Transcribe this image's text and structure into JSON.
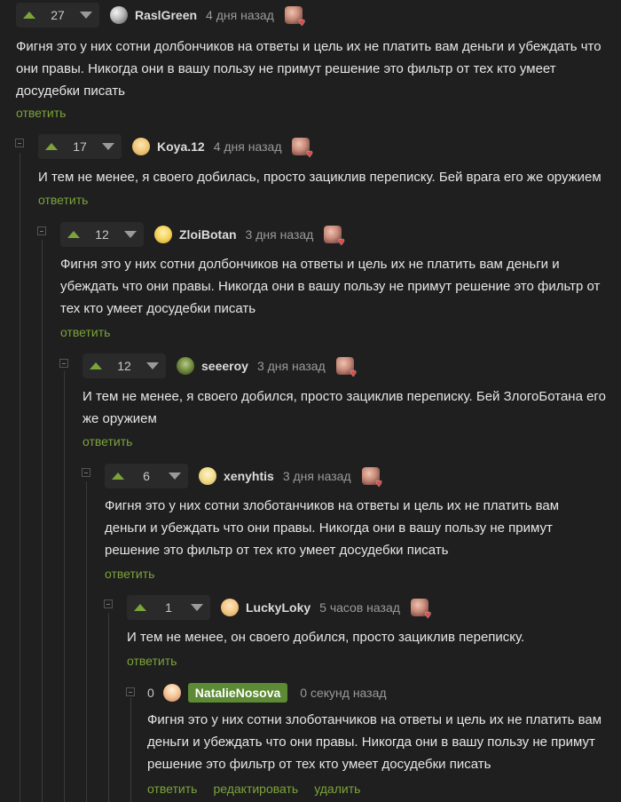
{
  "comments": [
    {
      "score": "27",
      "username": "RaslGreen",
      "time": "4 дня назад",
      "text": "Фигня это у них сотни долбончиков на ответы и цель их не платить вам деньги и убеждать что они правы. Никогда они в вашу пользу не примут решение это фильтр от тех кто умеет досудебки писать",
      "reply": "ответить"
    },
    {
      "score": "17",
      "username": "Koya.12",
      "time": "4 дня назад",
      "text": "И тем не менее, я своего добилась, просто зациклив переписку. Бей врага его же оружием",
      "reply": "ответить"
    },
    {
      "score": "12",
      "username": "ZloiBotan",
      "time": "3 дня назад",
      "text": "Фигня это у них сотни долбончиков на ответы и цель их не платить вам деньги и убеждать что они правы. Никогда они в вашу пользу не примут решение это фильтр от тех кто умеет досудебки писать",
      "reply": "ответить"
    },
    {
      "score": "12",
      "username": "seeeroy",
      "time": "3 дня назад",
      "text": "И тем не менее, я своего добился, просто зациклив переписку. Бей ЗлогоБотана его же оружием",
      "reply": "ответить"
    },
    {
      "score": "6",
      "username": "xenyhtis",
      "time": "3 дня назад",
      "text": "Фигня это у них сотни злоботанчиков на ответы и цель их не платить вам деньги и убеждать что они правы. Никогда они в вашу пользу не примут решение это фильтр от тех кто умеет досудебки писать",
      "reply": "ответить"
    },
    {
      "score": "1",
      "username": "LuckyLoky",
      "time": "5 часов назад",
      "text": "И тем не менее, он своего добился, просто зациклив переписку.",
      "reply": "ответить"
    },
    {
      "score": "0",
      "username": "NatalieNosova",
      "time": "0 секунд назад",
      "text": "Фигня это у них сотни злоботанчиков на ответы и цель их не платить вам деньги и убеждать что они правы. Никогда они в вашу пользу не примут решение это фильтр от тех кто умеет досудебки писать",
      "reply": "ответить",
      "edit": "редактировать",
      "delete": "удалить"
    }
  ],
  "colors": {
    "background": "#1f1f1f",
    "accent": "#7ba33a",
    "own_username_bg": "#5d8a34"
  }
}
